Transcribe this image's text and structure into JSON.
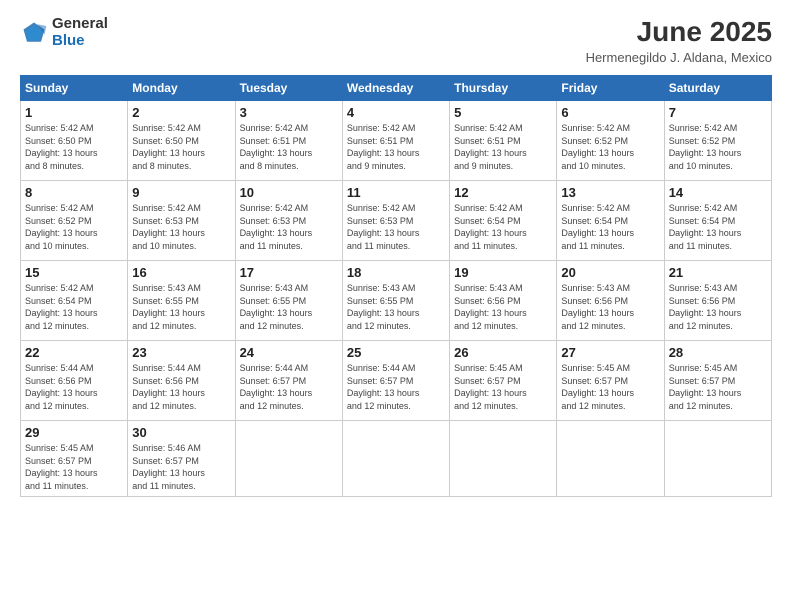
{
  "header": {
    "logo_general": "General",
    "logo_blue": "Blue",
    "month_title": "June 2025",
    "location": "Hermenegildo J. Aldana, Mexico"
  },
  "columns": [
    "Sunday",
    "Monday",
    "Tuesday",
    "Wednesday",
    "Thursday",
    "Friday",
    "Saturday"
  ],
  "weeks": [
    [
      {
        "day": "1",
        "info": "Sunrise: 5:42 AM\nSunset: 6:50 PM\nDaylight: 13 hours\nand 8 minutes."
      },
      {
        "day": "2",
        "info": "Sunrise: 5:42 AM\nSunset: 6:50 PM\nDaylight: 13 hours\nand 8 minutes."
      },
      {
        "day": "3",
        "info": "Sunrise: 5:42 AM\nSunset: 6:51 PM\nDaylight: 13 hours\nand 8 minutes."
      },
      {
        "day": "4",
        "info": "Sunrise: 5:42 AM\nSunset: 6:51 PM\nDaylight: 13 hours\nand 9 minutes."
      },
      {
        "day": "5",
        "info": "Sunrise: 5:42 AM\nSunset: 6:51 PM\nDaylight: 13 hours\nand 9 minutes."
      },
      {
        "day": "6",
        "info": "Sunrise: 5:42 AM\nSunset: 6:52 PM\nDaylight: 13 hours\nand 10 minutes."
      },
      {
        "day": "7",
        "info": "Sunrise: 5:42 AM\nSunset: 6:52 PM\nDaylight: 13 hours\nand 10 minutes."
      }
    ],
    [
      {
        "day": "8",
        "info": "Sunrise: 5:42 AM\nSunset: 6:52 PM\nDaylight: 13 hours\nand 10 minutes."
      },
      {
        "day": "9",
        "info": "Sunrise: 5:42 AM\nSunset: 6:53 PM\nDaylight: 13 hours\nand 10 minutes."
      },
      {
        "day": "10",
        "info": "Sunrise: 5:42 AM\nSunset: 6:53 PM\nDaylight: 13 hours\nand 11 minutes."
      },
      {
        "day": "11",
        "info": "Sunrise: 5:42 AM\nSunset: 6:53 PM\nDaylight: 13 hours\nand 11 minutes."
      },
      {
        "day": "12",
        "info": "Sunrise: 5:42 AM\nSunset: 6:54 PM\nDaylight: 13 hours\nand 11 minutes."
      },
      {
        "day": "13",
        "info": "Sunrise: 5:42 AM\nSunset: 6:54 PM\nDaylight: 13 hours\nand 11 minutes."
      },
      {
        "day": "14",
        "info": "Sunrise: 5:42 AM\nSunset: 6:54 PM\nDaylight: 13 hours\nand 11 minutes."
      }
    ],
    [
      {
        "day": "15",
        "info": "Sunrise: 5:42 AM\nSunset: 6:54 PM\nDaylight: 13 hours\nand 12 minutes."
      },
      {
        "day": "16",
        "info": "Sunrise: 5:43 AM\nSunset: 6:55 PM\nDaylight: 13 hours\nand 12 minutes."
      },
      {
        "day": "17",
        "info": "Sunrise: 5:43 AM\nSunset: 6:55 PM\nDaylight: 13 hours\nand 12 minutes."
      },
      {
        "day": "18",
        "info": "Sunrise: 5:43 AM\nSunset: 6:55 PM\nDaylight: 13 hours\nand 12 minutes."
      },
      {
        "day": "19",
        "info": "Sunrise: 5:43 AM\nSunset: 6:56 PM\nDaylight: 13 hours\nand 12 minutes."
      },
      {
        "day": "20",
        "info": "Sunrise: 5:43 AM\nSunset: 6:56 PM\nDaylight: 13 hours\nand 12 minutes."
      },
      {
        "day": "21",
        "info": "Sunrise: 5:43 AM\nSunset: 6:56 PM\nDaylight: 13 hours\nand 12 minutes."
      }
    ],
    [
      {
        "day": "22",
        "info": "Sunrise: 5:44 AM\nSunset: 6:56 PM\nDaylight: 13 hours\nand 12 minutes."
      },
      {
        "day": "23",
        "info": "Sunrise: 5:44 AM\nSunset: 6:56 PM\nDaylight: 13 hours\nand 12 minutes."
      },
      {
        "day": "24",
        "info": "Sunrise: 5:44 AM\nSunset: 6:57 PM\nDaylight: 13 hours\nand 12 minutes."
      },
      {
        "day": "25",
        "info": "Sunrise: 5:44 AM\nSunset: 6:57 PM\nDaylight: 13 hours\nand 12 minutes."
      },
      {
        "day": "26",
        "info": "Sunrise: 5:45 AM\nSunset: 6:57 PM\nDaylight: 13 hours\nand 12 minutes."
      },
      {
        "day": "27",
        "info": "Sunrise: 5:45 AM\nSunset: 6:57 PM\nDaylight: 13 hours\nand 12 minutes."
      },
      {
        "day": "28",
        "info": "Sunrise: 5:45 AM\nSunset: 6:57 PM\nDaylight: 13 hours\nand 12 minutes."
      }
    ],
    [
      {
        "day": "29",
        "info": "Sunrise: 5:45 AM\nSunset: 6:57 PM\nDaylight: 13 hours\nand 11 minutes."
      },
      {
        "day": "30",
        "info": "Sunrise: 5:46 AM\nSunset: 6:57 PM\nDaylight: 13 hours\nand 11 minutes."
      },
      {
        "day": "",
        "info": ""
      },
      {
        "day": "",
        "info": ""
      },
      {
        "day": "",
        "info": ""
      },
      {
        "day": "",
        "info": ""
      },
      {
        "day": "",
        "info": ""
      }
    ]
  ]
}
